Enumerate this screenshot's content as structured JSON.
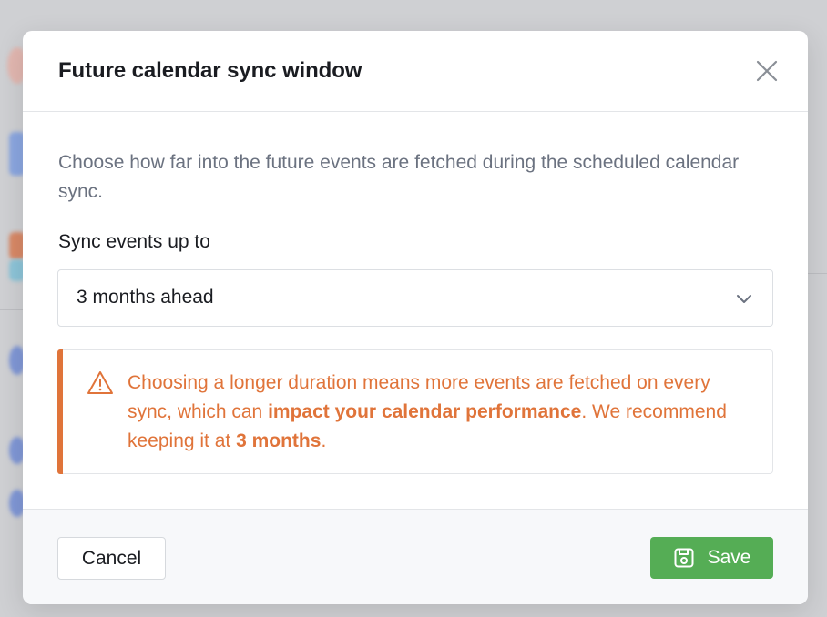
{
  "modal": {
    "title": "Future calendar sync window",
    "close_icon": "close-icon",
    "description": "Choose how far into the future events are fetched during the scheduled calendar sync.",
    "field_label": "Sync events up to",
    "select": {
      "value": "3 months ahead",
      "icon": "chevron-down-icon"
    },
    "warning": {
      "icon": "warning-triangle-icon",
      "text_part1": "Choosing a longer duration means more events are fetched on every sync, which can ",
      "text_bold1": "impact your calendar performance",
      "text_part2": ". We recommend keeping it at ",
      "text_bold2": "3 months",
      "text_part3": ".",
      "color": "#e0743a"
    },
    "footer": {
      "cancel_label": "Cancel",
      "save_label": "Save",
      "save_icon": "save-floppy-icon",
      "save_color": "#55ad55"
    }
  }
}
